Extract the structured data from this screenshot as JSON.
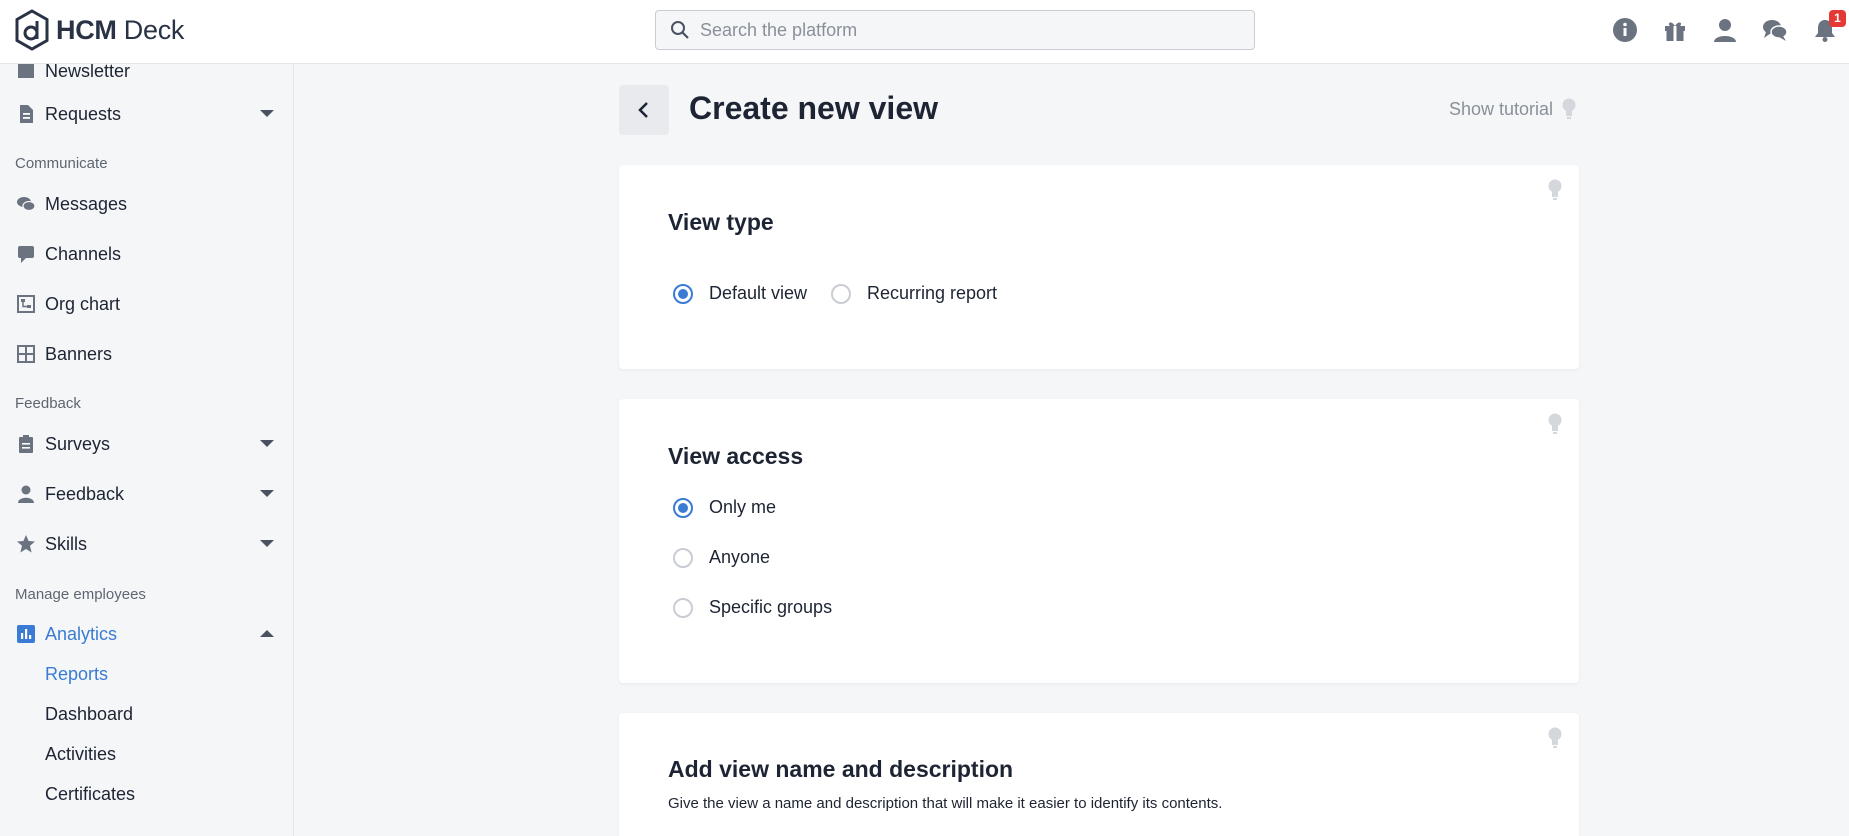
{
  "app": {
    "brand_bold": "HCM",
    "brand_light": " Deck"
  },
  "search": {
    "placeholder": "Search the platform"
  },
  "topbar": {
    "icons": [
      "info-icon",
      "gift-icon",
      "user-icon",
      "chat-icon",
      "bell-icon"
    ],
    "notification_count": "1"
  },
  "sidebar": {
    "newsletter": "Newsletter",
    "requests": "Requests",
    "section_communicate": "Communicate",
    "messages": "Messages",
    "channels": "Channels",
    "org_chart": "Org chart",
    "banners": "Banners",
    "section_feedback": "Feedback",
    "surveys": "Surveys",
    "feedback": "Feedback",
    "skills": "Skills",
    "section_manage": "Manage employees",
    "analytics": "Analytics",
    "reports": "Reports",
    "dashboard": "Dashboard",
    "activities": "Activities",
    "certificates": "Certificates"
  },
  "main": {
    "title": "Create new view",
    "show_tutorial": "Show tutorial",
    "view_type": {
      "title": "View type",
      "options": [
        "Default view",
        "Recurring report"
      ],
      "selected": "Default view"
    },
    "view_access": {
      "title": "View access",
      "options": [
        "Only me",
        "Anyone",
        "Specific groups"
      ],
      "selected": "Only me"
    },
    "name_desc": {
      "title": "Add view name and description",
      "description": "Give the view a name and description that will make it easier to identify its contents."
    }
  },
  "colors": {
    "accent": "#3a7bd5",
    "badge": "#e53935"
  }
}
